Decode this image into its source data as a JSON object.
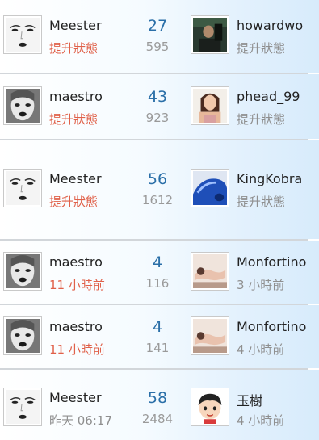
{
  "rows": [
    {
      "left_user": {
        "name": "Meester",
        "avatar": "face-sketch-avatar",
        "status": "提升狀態",
        "status_color": "red"
      },
      "count": "27",
      "total": "595",
      "right_user": {
        "name": "howardwo",
        "avatar": "dark-photo-avatar",
        "status": "提升狀態"
      }
    },
    {
      "left_user": {
        "name": "maestro",
        "avatar": "bw-portrait-avatar",
        "status": "提升狀態",
        "status_color": "red"
      },
      "count": "43",
      "total": "923",
      "right_user": {
        "name": "phead_99",
        "avatar": "girl-photo-avatar",
        "status": "提升狀態"
      }
    },
    {
      "left_user": {
        "name": "Meester",
        "avatar": "face-sketch-avatar",
        "status": "提升狀態",
        "status_color": "red"
      },
      "count": "56",
      "total": "1612",
      "right_user": {
        "name": "KingKobra",
        "avatar": "blue-car-avatar",
        "status": "提升狀態"
      }
    },
    {
      "left_user": {
        "name": "maestro",
        "avatar": "bw-portrait-avatar",
        "status": "11 小時前",
        "status_color": "red"
      },
      "count": "4",
      "total": "116",
      "right_user": {
        "name": "Monfortino",
        "avatar": "reclining-figure-avatar",
        "status": "3 小時前"
      }
    },
    {
      "left_user": {
        "name": "maestro",
        "avatar": "bw-portrait-avatar",
        "status": "11 小時前",
        "status_color": "red"
      },
      "count": "4",
      "total": "141",
      "right_user": {
        "name": "Monfortino",
        "avatar": "reclining-figure-avatar",
        "status": "4 小時前"
      }
    },
    {
      "left_user": {
        "name": "Meester",
        "avatar": "face-sketch-avatar",
        "status": "昨天 06:17",
        "status_color": "gray"
      },
      "count": "58",
      "total": "2484",
      "right_user": {
        "name": "玉樹",
        "avatar": "cartoon-boy-avatar",
        "status": "4 小時前"
      }
    }
  ],
  "colors": {
    "accent_number": "#2a6fa8",
    "status_red": "#e0614a",
    "status_gray": "#8f8f8f",
    "separator": "#d2d6da"
  }
}
